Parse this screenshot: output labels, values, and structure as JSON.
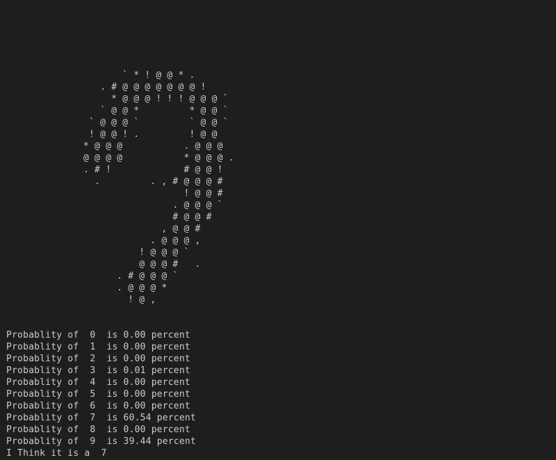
{
  "ascii_art": "       ` * ! @ @ * .\n   . # @ @ @ @ @ @ @ !\n     * @ @ @ ! ! ! @ @ @ `\n   ` @ @ *         * @ @ `\n ` @ @ @ `         ` @ @ `\n ! @ @ ! .         ! @ @\n* @ @ @           . @ @ @\n@ @ @ @           * @ @ @ .\n. # !             # @ @ !\n  .         . , # @ @ @ #\n                  ! @ @ #\n                . @ @ @ `\n                # @ @ #\n              , @ @ #\n            . @ @ @ ,\n          ! @ @ @ `\n          @ @ @ #   .\n      . # @ @ @ `\n      . @ @ @ *\n        ! @ ,",
  "output_lines": [
    "Probablity of  0  is 0.00 percent",
    "Probablity of  1  is 0.00 percent",
    "Probablity of  2  is 0.00 percent",
    "Probablity of  3  is 0.01 percent",
    "Probablity of  4  is 0.00 percent",
    "Probablity of  5  is 0.00 percent",
    "Probablity of  6  is 0.00 percent",
    "Probablity of  7  is 60.54 percent",
    "Probablity of  8  is 0.00 percent",
    "Probablity of  9  is 39.44 percent",
    "I Think it is a  7"
  ]
}
